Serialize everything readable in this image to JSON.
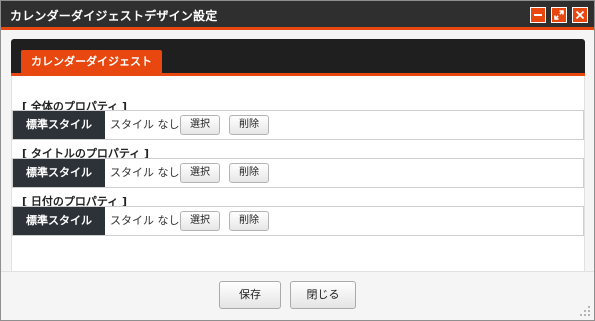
{
  "window": {
    "title": "カレンダーダイジェストデザイン設定",
    "controls": {
      "minimize_icon": "minimize-icon",
      "maximize_icon": "maximize-icon",
      "close_icon": "close-icon"
    }
  },
  "tabs": [
    {
      "label": "カレンダーダイジェスト",
      "active": true
    }
  ],
  "sections": [
    {
      "label": "[ 全体のプロパティ ]",
      "property": "標準スタイル",
      "value": "スタイル なし",
      "select_label": "選択",
      "delete_label": "削除"
    },
    {
      "label": "[ タイトルのプロパティ ]",
      "property": "標準スタイル",
      "value": "スタイル なし",
      "select_label": "選択",
      "delete_label": "削除"
    },
    {
      "label": "[ 日付のプロパティ ]",
      "property": "標準スタイル",
      "value": "スタイル なし",
      "select_label": "選択",
      "delete_label": "削除"
    }
  ],
  "footer": {
    "save_label": "保存",
    "close_label": "閉じる"
  },
  "colors": {
    "accent": "#e8470f",
    "titlebar": "#2f2f2f",
    "header_cell": "#2d3138"
  }
}
